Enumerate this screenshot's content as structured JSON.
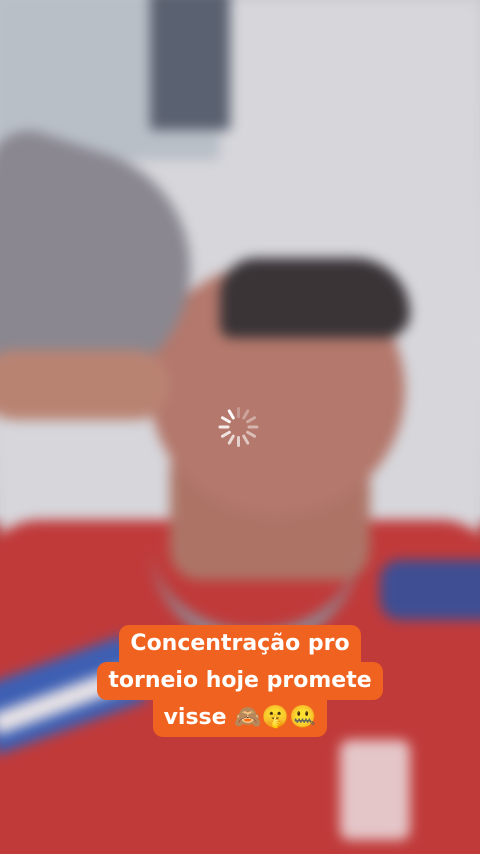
{
  "video": {
    "caption_lines": [
      "Concentração pro",
      "torneio hoje promete",
      "visse 🙈🤫🤐"
    ]
  },
  "player": {
    "state": "loading"
  },
  "colors": {
    "caption_bg": "#f0621f",
    "caption_text": "#ffffff"
  }
}
